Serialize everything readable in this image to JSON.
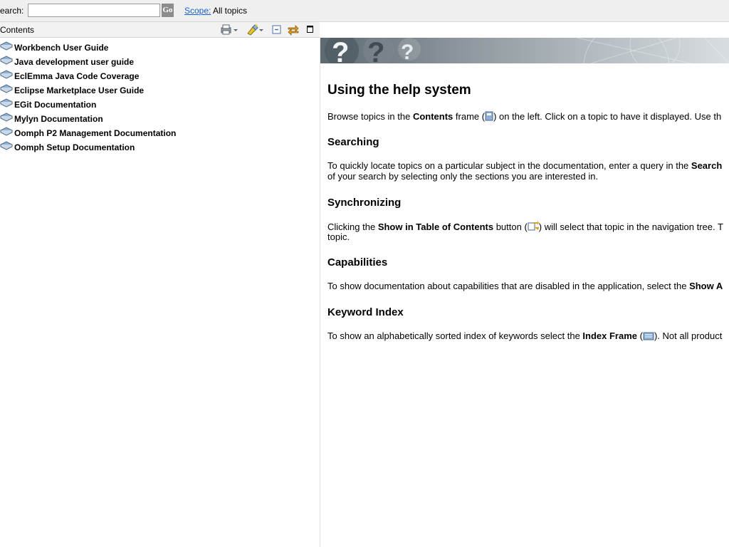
{
  "search": {
    "label": "earch:",
    "value": "",
    "go_label": "Go",
    "scope_link": "Scope:",
    "scope_value": "All topics"
  },
  "toc_header": {
    "title": "Contents",
    "icons": [
      "print-icon",
      "highlight-icon",
      "collapse-all-icon",
      "link-with-contents-icon",
      "maximize-icon"
    ]
  },
  "toc": {
    "items": [
      {
        "label": "Workbench User Guide"
      },
      {
        "label": "Java development user guide"
      },
      {
        "label": "EclEmma Java Code Coverage"
      },
      {
        "label": "Eclipse Marketplace User Guide"
      },
      {
        "label": "EGit Documentation"
      },
      {
        "label": "Mylyn Documentation"
      },
      {
        "label": "Oomph P2 Management Documentation"
      },
      {
        "label": "Oomph Setup Documentation"
      }
    ]
  },
  "content": {
    "title": "Using the help system",
    "intro": {
      "a": "Browse topics in the ",
      "b": "Contents",
      "c": " frame (",
      "d": ") on the left. Click on a topic to have it displayed. Use th"
    },
    "searching": {
      "heading": "Searching",
      "l1a": "To quickly locate topics on a particular subject in the documentation, enter a query in the ",
      "l1b": "Search",
      "l2": "of your search by selecting only the sections you are interested in."
    },
    "sync": {
      "heading": "Synchronizing",
      "l1a": "Clicking the ",
      "l1b": "Show in Table of Contents",
      "l1c": " button (",
      "l1d": ") will select that topic in the navigation tree. T",
      "l2": "topic."
    },
    "capabilities": {
      "heading": "Capabilities",
      "l1a": "To show documentation about capabilities that are disabled in the application, select the ",
      "l1b": "Show A"
    },
    "keyword": {
      "heading": "Keyword Index",
      "l1a": "To show an alphabetically sorted index of keywords select the ",
      "l1b": "Index Frame",
      "l1c": " (",
      "l1d": "). Not all product"
    }
  },
  "colors": {
    "link": "#1a5fd0",
    "toolbar_bg": "#efefef",
    "banner_dark": "#5e6a72"
  }
}
